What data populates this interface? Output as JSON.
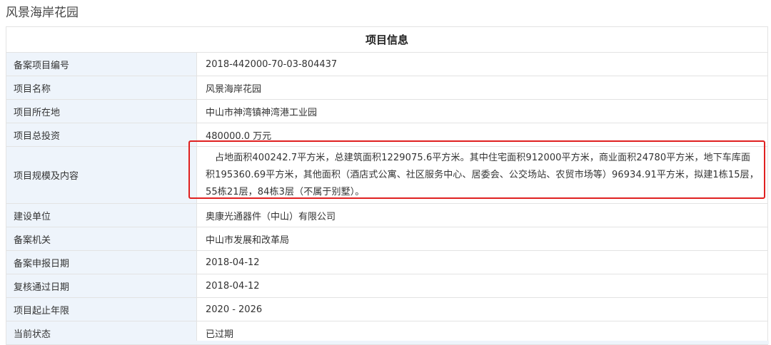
{
  "page": {
    "title": "风景海岸花园"
  },
  "table": {
    "header": "项目信息",
    "rows": [
      {
        "label": "备案项目编号",
        "value": "2018-442000-70-03-804437"
      },
      {
        "label": "项目名称",
        "value": "风景海岸花园"
      },
      {
        "label": "项目所在地",
        "value": "中山市神湾镇神湾港工业园"
      },
      {
        "label": "项目总投资",
        "value": "480000.0 万元"
      },
      {
        "label": "项目规模及内容",
        "value": "占地面积400242.7平方米，总建筑面积1229075.6平方米。其中住宅面积912000平方米，商业面积24780平方米，地下车库面积195360.69平方米，其他面积（酒店式公寓、社区服务中心、居委会、公交场站、农贸市场等）96934.91平方米，拟建1栋15层，55栋21层，84栋3层（不属于别墅）。"
      },
      {
        "label": "建设单位",
        "value": "奥康光通器件（中山）有限公司"
      },
      {
        "label": "备案机关",
        "value": "中山市发展和改革局"
      },
      {
        "label": "备案申报日期",
        "value": "2018-04-12"
      },
      {
        "label": "复核通过日期",
        "value": "2018-04-12"
      },
      {
        "label": "项目起止年限",
        "value": "2020 - 2026"
      },
      {
        "label": "当前状态",
        "value": "已过期"
      }
    ]
  },
  "colors": {
    "label_bg": "#eef4fb",
    "border": "#e3e3e3",
    "highlight": "#e02020"
  }
}
